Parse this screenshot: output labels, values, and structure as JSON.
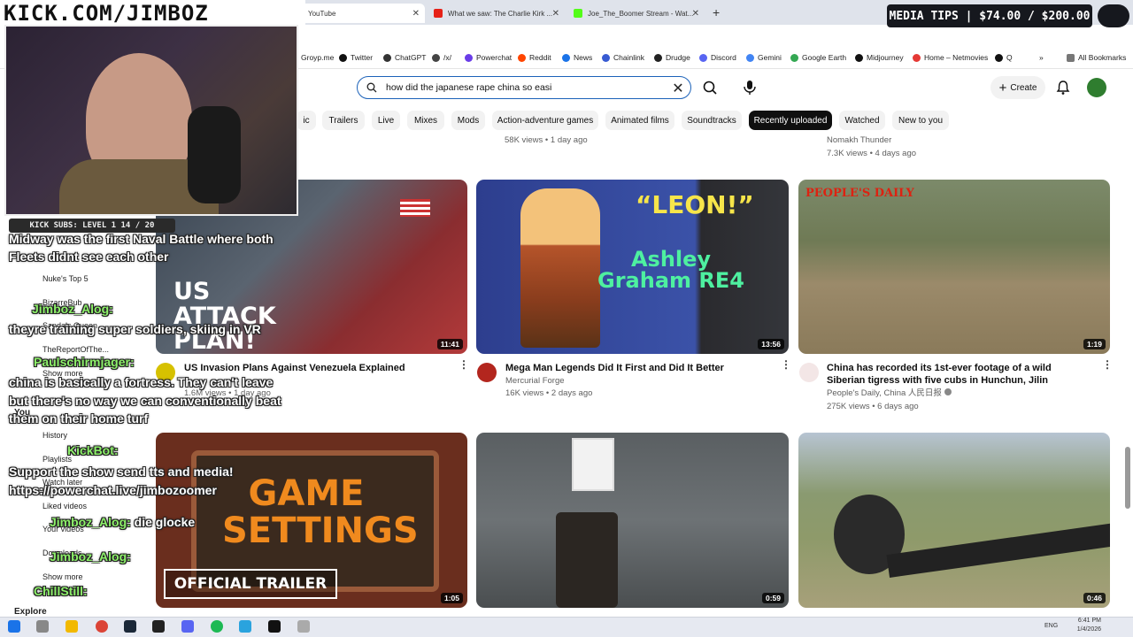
{
  "tabs": [
    {
      "label": "YouTube",
      "active": true
    },
    {
      "label": "What we saw: The Charlie Kirk ..."
    },
    {
      "label": "Joe_The_Boomer Stream - Wat..."
    }
  ],
  "bookmarks": [
    "Groyp.me",
    "Twitter",
    "ChatGPT",
    "/x/",
    "Powerchat",
    "Reddit",
    "News",
    "Chainlink",
    "Drudge",
    "Discord",
    "Gemini",
    "Google Earth",
    "Midjourney",
    "Home – Netmovies",
    "Q"
  ],
  "all_bookmarks": "All Bookmarks",
  "search": {
    "value": "how did the japanese rape china so easi"
  },
  "header": {
    "create_label": "Create"
  },
  "chips": [
    "ic",
    "Trailers",
    "Live",
    "Mixes",
    "Mods",
    "Action-adventure games",
    "Animated films",
    "Soundtracks",
    "Recently uploaded",
    "Watched",
    "New to you"
  ],
  "top_row_meta": {
    "left": "58K views • 1 day ago",
    "right_channel": "Nomakh Thunder",
    "right_meta": "7.3K views • 4 days ago"
  },
  "videos": [
    {
      "title": "US Invasion Plans Against Venezuela Explained",
      "channel": "",
      "meta": "1.6M views • 1 day ago",
      "duration": "11:41",
      "thumb_text": "US ATTACK PLAN!"
    },
    {
      "title": "Mega Man Legends Did It First and Did It Better",
      "channel": "Mercurial Forge",
      "meta": "16K views • 2 days ago",
      "duration": "13:56",
      "thumb_text_1": "“LEON!”",
      "thumb_text_2": "Ashley Graham RE4"
    },
    {
      "title": "China has recorded its 1st-ever footage of a wild Siberian tigress with five cubs in Hunchun, Jilin",
      "channel": "People's Daily, China 人民日报",
      "meta": "275K views • 6 days ago",
      "duration": "1:19",
      "thumb_text": "PEOPLE'S DAILY"
    },
    {
      "duration": "1:05",
      "thumb_text_1": "GAME SETTINGS",
      "thumb_text_2": "OFFICIAL TRAILER"
    },
    {
      "duration": "0:59"
    },
    {
      "duration": "0:46"
    }
  ],
  "overlay": {
    "kick_banner": "KICK.COM/JIMBOZ",
    "media_tips": "MEDIA TIPS | $74.00 / $200.00",
    "subs_bar": "KICK SUBS: LEVEL 1 14 / 20"
  },
  "sidebar": [
    "Nuke's Top 5",
    "BizarreBub",
    "Sandals Queen",
    "TheReportOfThe...",
    "Show more",
    "You",
    "History",
    "Playlists",
    "Watch later",
    "Liked videos",
    "Your videos",
    "Downloads",
    "Show more",
    "Explore"
  ],
  "chat": [
    {
      "text": "Midway was the first Naval Battle where both"
    },
    {
      "text": "Fleets didnt see each other"
    },
    {
      "name": "Jimboz_Alog:",
      "text": ""
    },
    {
      "text": "theyre training super soldiers, skiing in VR"
    },
    {
      "name": "Paulschirmjager:",
      "text": ""
    },
    {
      "text": "china is basically a fortress. They can't leave"
    },
    {
      "text": "but there's no way we can conventionally beat"
    },
    {
      "text": "them on their home turf"
    },
    {
      "name": "KickBot:",
      "text": ""
    },
    {
      "text": "Support the show send tts and media!"
    },
    {
      "text": "https://powerchat.live/jimbozoomer"
    },
    {
      "name": "Jimboz_Alog:",
      "text": "die glocke"
    },
    {
      "name": "Jimboz_Alog:",
      "text": ""
    },
    {
      "name": "ChillStill:",
      "text": ""
    }
  ],
  "taskbar": {
    "lang": "ENG",
    "time": "6:41 PM",
    "date": "1/4/2026"
  }
}
